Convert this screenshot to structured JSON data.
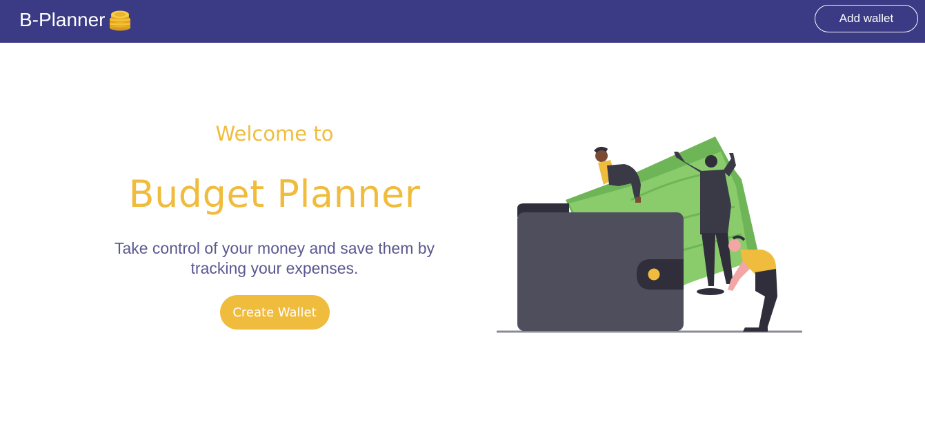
{
  "navbar": {
    "brand": "B-Planner",
    "brand_icon": "coin-stack-icon",
    "add_wallet_label": "Add wallet"
  },
  "hero": {
    "welcome": "Welcome to",
    "title": "Budget Planner",
    "tagline": "Take control of your money and save them by tracking your expenses.",
    "create_wallet_label": "Create Wallet",
    "illustration": "wallet-illustration"
  },
  "colors": {
    "navbar": "#3b3a84",
    "accent": "#f0bc3d",
    "tagline": "#5a5890",
    "wallet": "#4f4e5c",
    "money": "#8acc6c"
  }
}
